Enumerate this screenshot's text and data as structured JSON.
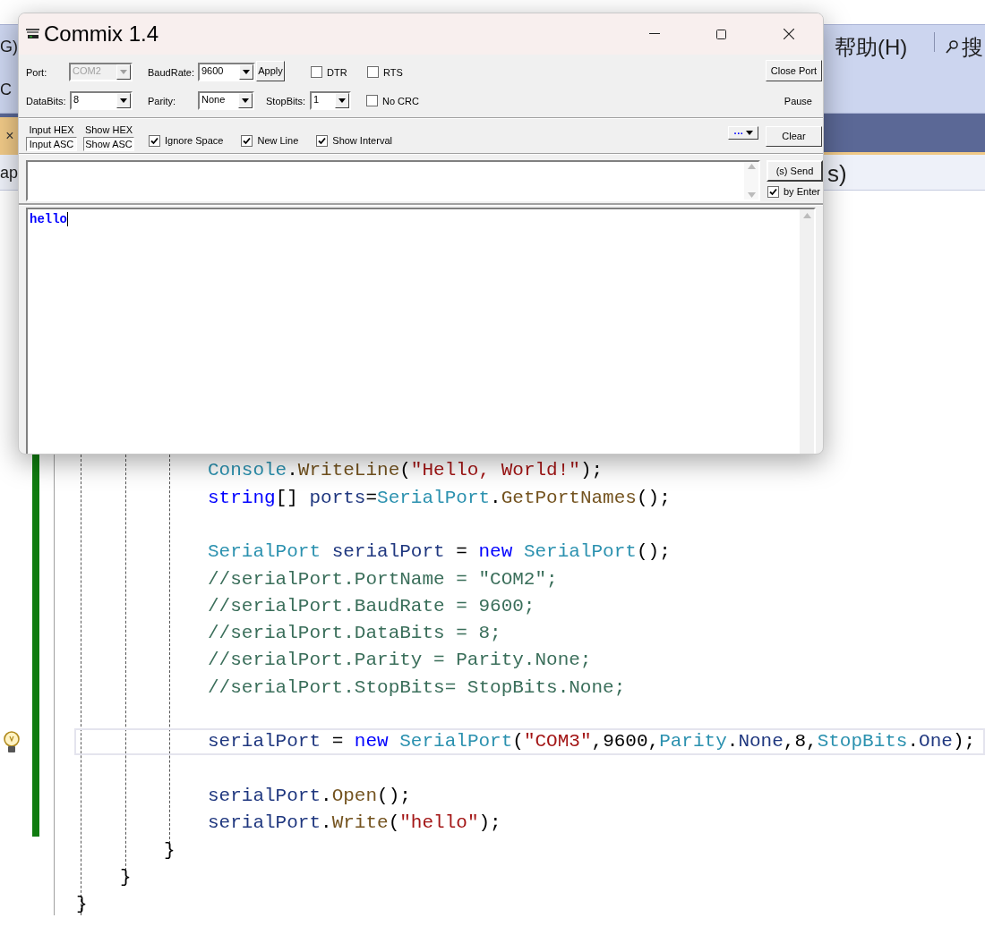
{
  "ide": {
    "menu": [
      {
        "text": "G)"
      },
      {
        "text": "帮助(H)"
      }
    ],
    "search": {
      "text": "搜"
    },
    "toolbar_text": "C",
    "tab": {
      "close": "×"
    },
    "breadcrumb": [
      "ap",
      "s)"
    ],
    "code": {
      "close": "}",
      "children": [
        {
          "close": "}",
          "children": [
            {
              "close": "}",
              "lines": [
                {
                  "kind": "code",
                  "current": false,
                  "tokens": [
                    {
                      "t": "Console",
                      "color": "#2b91af"
                    },
                    {
                      "t": ".",
                      "color": "#000000"
                    },
                    {
                      "t": "WriteLine",
                      "color": "#74531f"
                    },
                    {
                      "t": "(",
                      "color": "#000000"
                    },
                    {
                      "t": "\"Hello, World!\"",
                      "color": "#a31515"
                    },
                    {
                      "t": ");",
                      "color": "#000000"
                    }
                  ]
                },
                {
                  "kind": "code",
                  "current": false,
                  "tokens": [
                    {
                      "t": "string",
                      "color": "#0000ff"
                    },
                    {
                      "t": "[] ",
                      "color": "#000000"
                    },
                    {
                      "t": "ports",
                      "color": "#1f377f"
                    },
                    {
                      "t": "=",
                      "color": "#000000"
                    },
                    {
                      "t": "SerialPort",
                      "color": "#2b91af"
                    },
                    {
                      "t": ".",
                      "color": "#000000"
                    },
                    {
                      "t": "GetPortNames",
                      "color": "#74531f"
                    },
                    {
                      "t": "();",
                      "color": "#000000"
                    }
                  ]
                },
                {
                  "kind": "blank",
                  "current": false
                },
                {
                  "kind": "code",
                  "current": false,
                  "tokens": [
                    {
                      "t": "SerialPort ",
                      "color": "#2b91af"
                    },
                    {
                      "t": "serialPort",
                      "color": "#1f377f"
                    },
                    {
                      "t": " = ",
                      "color": "#000000"
                    },
                    {
                      "t": "new ",
                      "color": "#0000ff"
                    },
                    {
                      "t": "SerialPort",
                      "color": "#2b91af"
                    },
                    {
                      "t": "();",
                      "color": "#000000"
                    }
                  ]
                },
                {
                  "kind": "code",
                  "current": false,
                  "tokens": [
                    {
                      "t": "//serialPort.PortName = \"COM2\";",
                      "color": "#3a6e5a"
                    }
                  ]
                },
                {
                  "kind": "code",
                  "current": false,
                  "tokens": [
                    {
                      "t": "//serialPort.BaudRate = 9600;",
                      "color": "#3a6e5a"
                    }
                  ]
                },
                {
                  "kind": "code",
                  "current": false,
                  "tokens": [
                    {
                      "t": "//serialPort.DataBits = 8;",
                      "color": "#3a6e5a"
                    }
                  ]
                },
                {
                  "kind": "code",
                  "current": false,
                  "tokens": [
                    {
                      "t": "//serialPort.Parity = Parity.None;",
                      "color": "#3a6e5a"
                    }
                  ]
                },
                {
                  "kind": "code",
                  "current": false,
                  "tokens": [
                    {
                      "t": "//serialPort.StopBits= StopBits.None;",
                      "color": "#3a6e5a"
                    }
                  ]
                },
                {
                  "kind": "blank",
                  "current": false
                },
                {
                  "kind": "code",
                  "current": true,
                  "tokens": [
                    {
                      "t": "serialPort",
                      "color": "#1f377f"
                    },
                    {
                      "t": " = ",
                      "color": "#000000"
                    },
                    {
                      "t": "new ",
                      "color": "#0000ff"
                    },
                    {
                      "t": "SerialPort",
                      "color": "#2b91af"
                    },
                    {
                      "t": "(",
                      "color": "#000000"
                    },
                    {
                      "t": "\"COM3\"",
                      "color": "#a31515"
                    },
                    {
                      "t": ",9600,",
                      "color": "#000000"
                    },
                    {
                      "t": "Parity",
                      "color": "#2b91af"
                    },
                    {
                      "t": ".",
                      "color": "#000000"
                    },
                    {
                      "t": "None",
                      "color": "#1f377f"
                    },
                    {
                      "t": ",8,",
                      "color": "#000000"
                    },
                    {
                      "t": "StopBits",
                      "color": "#2b91af"
                    },
                    {
                      "t": ".",
                      "color": "#000000"
                    },
                    {
                      "t": "One",
                      "color": "#1f377f"
                    },
                    {
                      "t": ");",
                      "color": "#000000"
                    }
                  ]
                },
                {
                  "kind": "blank",
                  "current": false
                },
                {
                  "kind": "code",
                  "current": false,
                  "tokens": [
                    {
                      "t": "serialPort",
                      "color": "#1f377f"
                    },
                    {
                      "t": ".",
                      "color": "#000000"
                    },
                    {
                      "t": "Open",
                      "color": "#74531f"
                    },
                    {
                      "t": "();",
                      "color": "#000000"
                    }
                  ]
                },
                {
                  "kind": "code",
                  "current": false,
                  "tokens": [
                    {
                      "t": "serialPort",
                      "color": "#1f377f"
                    },
                    {
                      "t": ".",
                      "color": "#000000"
                    },
                    {
                      "t": "Write",
                      "color": "#74531f"
                    },
                    {
                      "t": "(",
                      "color": "#000000"
                    },
                    {
                      "t": "\"hello\"",
                      "color": "#a31515"
                    },
                    {
                      "t": ");",
                      "color": "#000000"
                    }
                  ]
                }
              ]
            }
          ]
        }
      ]
    }
  },
  "commix": {
    "title": "Commix 1.4",
    "row1": [
      {
        "kind": "label",
        "text": "Port:"
      },
      {
        "kind": "combo",
        "value": "COM2",
        "disabled": true
      },
      {
        "kind": "label",
        "text": "BaudRate:"
      },
      {
        "kind": "combo",
        "value": "9600",
        "disabled": false
      },
      {
        "kind": "button",
        "text": "Apply"
      },
      {
        "kind": "check",
        "text": "DTR",
        "checked": false
      },
      {
        "kind": "check",
        "text": "RTS",
        "checked": false
      }
    ],
    "row2": [
      {
        "kind": "label",
        "text": "DataBits:"
      },
      {
        "kind": "combo",
        "value": "8",
        "disabled": false
      },
      {
        "kind": "label",
        "text": "Parity:"
      },
      {
        "kind": "combo",
        "value": "None",
        "disabled": false
      },
      {
        "kind": "label",
        "text": "StopBits:"
      },
      {
        "kind": "combo",
        "value": "1",
        "disabled": false
      },
      {
        "kind": "check",
        "text": "No CRC",
        "checked": false
      }
    ],
    "close_port": "Close Port",
    "pause": "Pause",
    "input_mode": [
      {
        "text": "Input HEX",
        "selected": false
      },
      {
        "text": "Input ASC",
        "selected": true
      }
    ],
    "show_mode": [
      {
        "text": "Show HEX",
        "selected": false
      },
      {
        "text": "Show ASC",
        "selected": true
      }
    ],
    "options": [
      {
        "text": "Ignore Space",
        "checked": true
      },
      {
        "text": "New Line",
        "checked": true
      },
      {
        "text": "Show Interval",
        "checked": true
      }
    ],
    "more": "···",
    "clear": "Clear",
    "send": "(s) Send",
    "by_enter": {
      "text": "by Enter",
      "checked": true
    },
    "output": "hello"
  }
}
